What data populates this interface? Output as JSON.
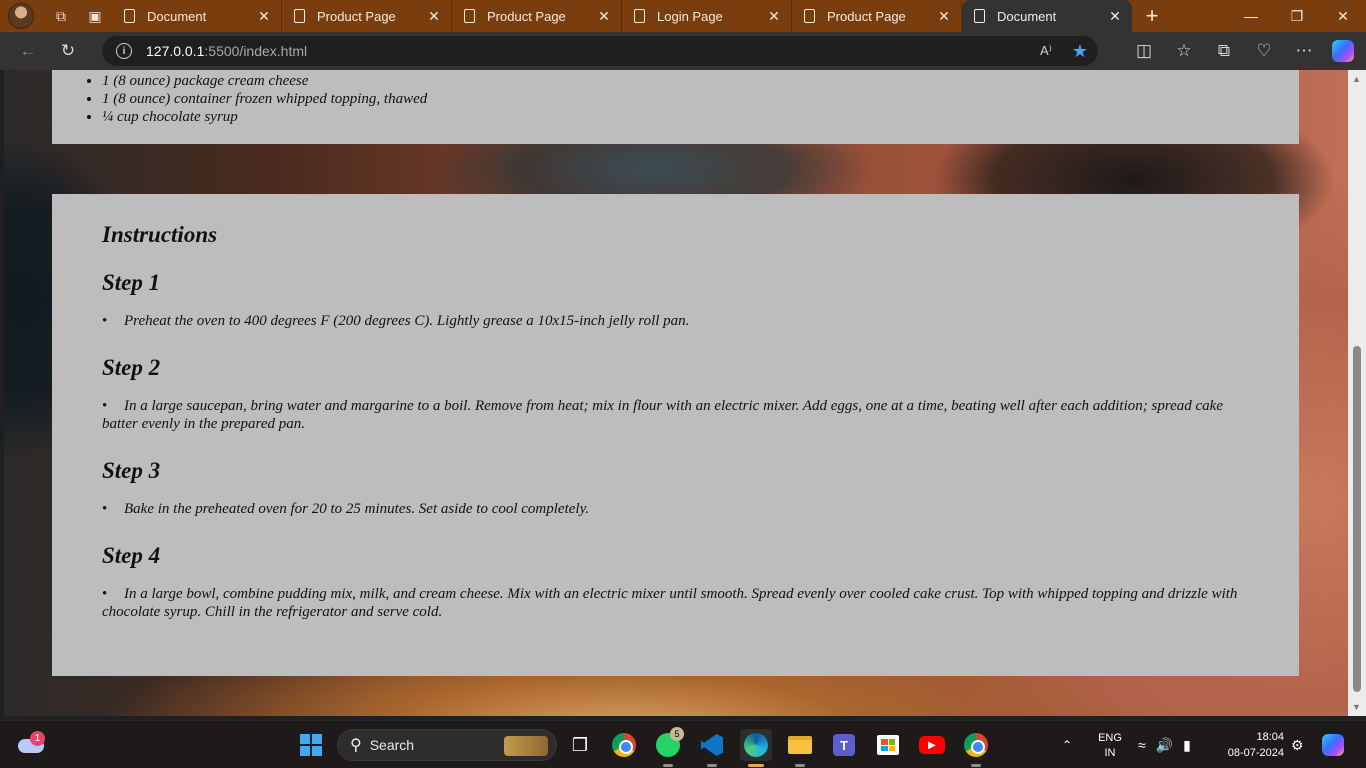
{
  "browser": {
    "tabs": [
      {
        "label": "Document",
        "active": false
      },
      {
        "label": "Product Page",
        "active": false
      },
      {
        "label": "Product Page",
        "active": false
      },
      {
        "label": "Login Page",
        "active": false
      },
      {
        "label": "Product Page",
        "active": false
      },
      {
        "label": "Document",
        "active": true
      }
    ],
    "url_host": "127.0.0.1",
    "url_path": ":5500/index.html",
    "read_aloud_label": "A⁾"
  },
  "page": {
    "ingredients": [
      "1 (8 ounce) package cream cheese",
      "1 (8 ounce) container frozen whipped topping, thawed",
      "¼ cup chocolate syrup"
    ],
    "instructions_title": "Instructions",
    "steps": [
      {
        "title": "Step 1",
        "text": "Preheat the oven to 400 degrees F (200 degrees C). Lightly grease a 10x15-inch jelly roll pan."
      },
      {
        "title": "Step 2",
        "text": "In a large saucepan, bring water and margarine to a boil. Remove from heat; mix in flour with an electric mixer. Add eggs, one at a time, beating well after each addition; spread cake batter evenly in the prepared pan."
      },
      {
        "title": "Step 3",
        "text": "Bake in the preheated oven for 20 to 25 minutes. Set aside to cool completely."
      },
      {
        "title": "Step 4",
        "text": "In a large bowl, combine pudding mix, milk, and cream cheese. Mix with an electric mixer until smooth. Spread evenly over cooled cake crust. Top with whipped topping and drizzle with chocolate syrup. Chill in the refrigerator and serve cold."
      }
    ]
  },
  "taskbar": {
    "weather_badge": "1",
    "search_label": "Search",
    "whatsapp_badge": "5",
    "teams_letter": "T",
    "language": {
      "line1": "ENG",
      "line2": "IN"
    },
    "clock": {
      "time": "18:04",
      "date": "08-07-2024"
    }
  },
  "colors": {
    "tabstrip": "#7a3d0e",
    "toolbar": "#333333",
    "card": "#bdbdbd",
    "favorite_star": "#4aa3ff"
  }
}
